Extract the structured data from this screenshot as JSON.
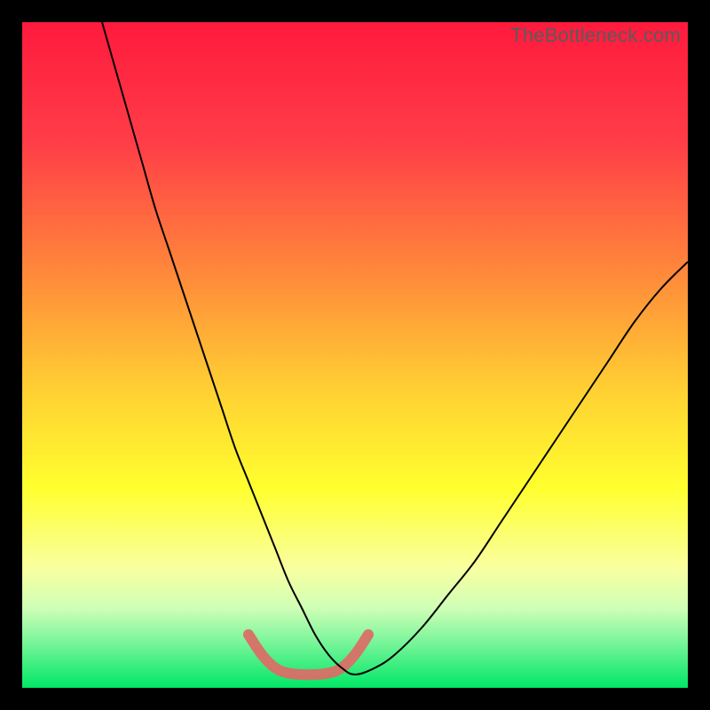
{
  "watermark": "TheBottleneck.com",
  "chart_data": {
    "type": "line",
    "title": "",
    "xlabel": "",
    "ylabel": "",
    "xlim": [
      0,
      100
    ],
    "ylim": [
      0,
      100
    ],
    "grid": false,
    "legend": false,
    "gradient_stops": [
      {
        "offset": 0.0,
        "color": "#ff1a3d"
      },
      {
        "offset": 0.18,
        "color": "#ff3d48"
      },
      {
        "offset": 0.38,
        "color": "#ff8a3a"
      },
      {
        "offset": 0.55,
        "color": "#ffcf33"
      },
      {
        "offset": 0.7,
        "color": "#ffff2e"
      },
      {
        "offset": 0.82,
        "color": "#f9ffa0"
      },
      {
        "offset": 0.88,
        "color": "#cfffb6"
      },
      {
        "offset": 0.93,
        "color": "#7cf59b"
      },
      {
        "offset": 1.0,
        "color": "#00e765"
      }
    ],
    "series": [
      {
        "name": "bottleneck-curve",
        "color": "#000000",
        "width": 2,
        "x": [
          12,
          14,
          16,
          18,
          20,
          22,
          24,
          26,
          28,
          30,
          32,
          34,
          36,
          38,
          40,
          42,
          44,
          46,
          48,
          50,
          53,
          56,
          60,
          64,
          68,
          72,
          76,
          80,
          84,
          88,
          92,
          96,
          100
        ],
        "y": [
          100,
          93,
          86,
          79,
          72,
          66,
          60,
          54,
          48,
          42,
          36,
          31,
          26,
          21,
          16,
          12,
          8,
          5,
          3,
          2,
          3,
          5,
          9,
          14,
          19,
          25,
          31,
          37,
          43,
          49,
          55,
          60,
          64
        ]
      },
      {
        "name": "good-range-band",
        "color": "#d96f67",
        "width": 12,
        "cap": "round",
        "x": [
          34,
          36,
          38,
          40,
          42,
          44,
          46,
          48,
          50,
          52
        ],
        "y": [
          8,
          5,
          3,
          2.2,
          2,
          2,
          2.2,
          3,
          5,
          8
        ]
      }
    ]
  }
}
